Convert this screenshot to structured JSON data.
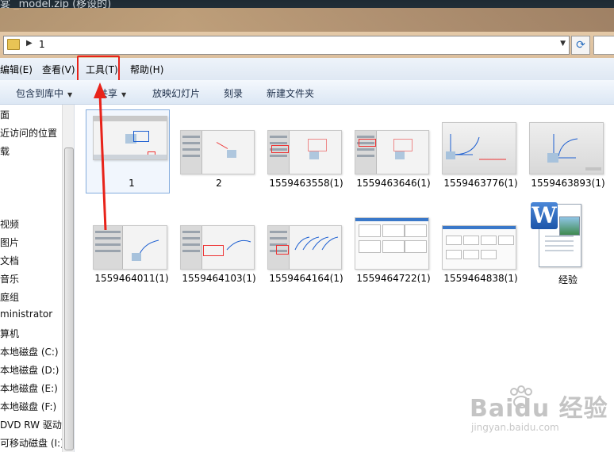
{
  "window": {
    "title": "宴 _model.zip (移设的)"
  },
  "address": {
    "path": "1"
  },
  "menubar": {
    "items": [
      "编辑(E)",
      "查看(V)",
      "工具(T)",
      "帮助(H)"
    ]
  },
  "commandbar": {
    "include_library": "包含到库中",
    "share": "共享",
    "slideshow": "放映幻灯片",
    "burn": "刻录",
    "new_folder": "新建文件夹"
  },
  "nav": {
    "items": [
      "面",
      "近访问的位置",
      "载",
      "视频",
      "图片",
      "文档",
      "音乐",
      "庭组",
      "ministrator",
      "算机",
      "本地磁盘 (C:)",
      "本地磁盘 (D:)",
      "本地磁盘 (E:)",
      "本地磁盘 (F:)",
      "DVD RW 驱动",
      "可移动磁盘 (I:)"
    ]
  },
  "files": [
    {
      "name": "1",
      "kind": "ui"
    },
    {
      "name": "2",
      "kind": "ui"
    },
    {
      "name": "1559463558(1)",
      "kind": "ui"
    },
    {
      "name": "1559463646(1)",
      "kind": "ui"
    },
    {
      "name": "1559463776(1)",
      "kind": "curve"
    },
    {
      "name": "1559463893(1)",
      "kind": "curve"
    },
    {
      "name": "1559464011(1)",
      "kind": "ui"
    },
    {
      "name": "1559464103(1)",
      "kind": "ui"
    },
    {
      "name": "1559464164(1)",
      "kind": "ui"
    },
    {
      "name": "1559464722(1)",
      "kind": "doc"
    },
    {
      "name": "1559464838(1)",
      "kind": "doc"
    },
    {
      "name": "经验",
      "kind": "word"
    }
  ],
  "watermark": {
    "brand": "Baidu 经验",
    "url": "jingyan.baidu.com"
  },
  "colors": {
    "highlight": "#e8231a",
    "selection": "#84acdd",
    "accent": "#1d5fd1"
  },
  "icons": {
    "folder": "folder-icon",
    "refresh": "refresh-icon",
    "word": "word-document-icon"
  }
}
